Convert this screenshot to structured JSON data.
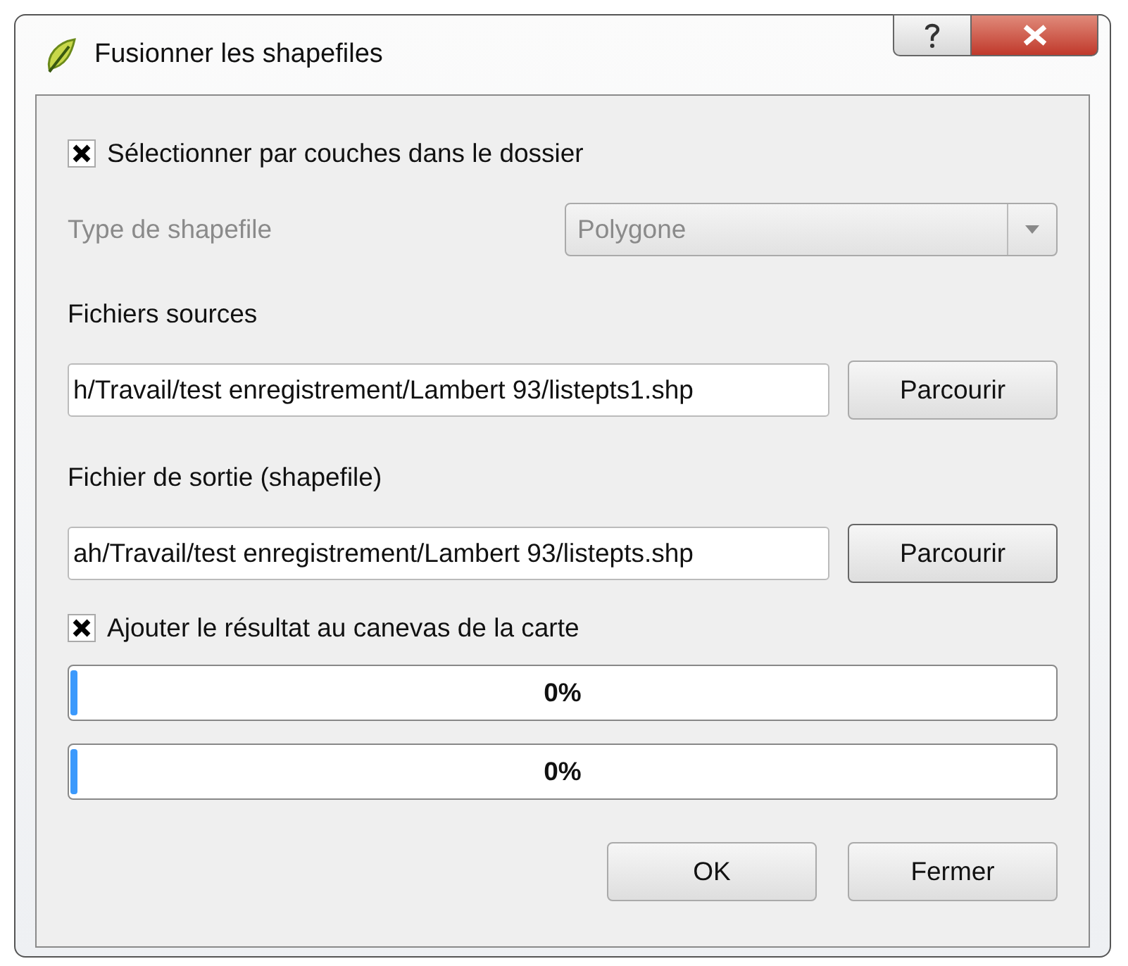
{
  "window": {
    "title": "Fusionner les shapefiles"
  },
  "select_by_folder": {
    "label": "Sélectionner par couches dans le dossier",
    "checked": true
  },
  "shapefile_type": {
    "label": "Type de shapefile",
    "value": "Polygone",
    "disabled": true
  },
  "source_files": {
    "label": "Fichiers sources",
    "value": "h/Travail/test enregistrement/Lambert 93/listepts1.shp",
    "button": "Parcourir"
  },
  "output_file": {
    "label": "Fichier de sortie (shapefile)",
    "value": "ah/Travail/test enregistrement/Lambert 93/listepts.shp",
    "button": "Parcourir"
  },
  "add_to_canvas": {
    "label": "Ajouter le résultat au canevas de la carte",
    "checked": true
  },
  "progress": [
    {
      "level": 0,
      "reading": "0%"
    },
    {
      "level": 0,
      "reading": "0%"
    }
  ],
  "buttons": [
    "OK",
    "Fermer"
  ]
}
